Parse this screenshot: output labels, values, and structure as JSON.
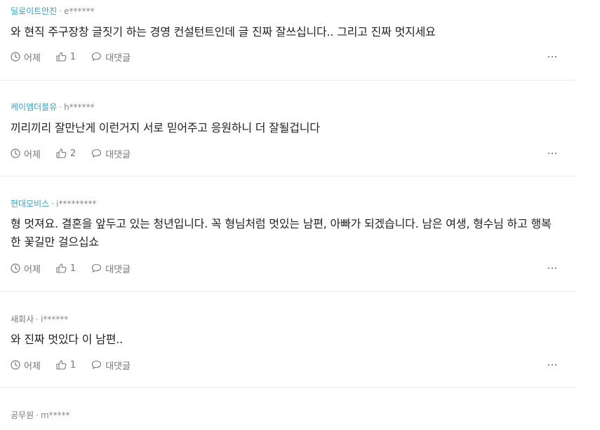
{
  "comments": [
    {
      "company": "딜로이트안진",
      "user": "e******",
      "text": "와 현직 주구장창 글짓기 하는 경영 컨설턴트인데 글 진짜 잘쓰십니다.. 그리고 진짜 멋지세요",
      "time": "어제",
      "likes": "1",
      "reply": "대댓글"
    },
    {
      "company": "케이엠더블유",
      "user": "h******",
      "text": "끼리끼리 잘만난게 이런거지 서로 믿어주고 응원하니 더 잘될겁니다",
      "time": "어제",
      "likes": "2",
      "reply": "대댓글"
    },
    {
      "company": "현대모비스",
      "user": "i*********",
      "text": "형 멋져요. 결혼을 앞두고 있는 청년입니다. 꼭 형님처럼 멋있는 남편, 아빠가 되겠습니다. 남은 여생, 형수님 하고 행복한 꽃길만 걸으십쇼",
      "time": "어제",
      "likes": "1",
      "reply": "대댓글"
    },
    {
      "company": "새회사",
      "user": "i******",
      "text": "와 진짜 멋있다 이 남편..",
      "time": "어제",
      "likes": "1",
      "reply": "대댓글"
    },
    {
      "company": "공무원",
      "user": "m*****"
    }
  ],
  "colors": {
    "company_link": "#3a9ec4",
    "company_plain": "#777777",
    "meta_text": "#888888",
    "divider": "#ececec"
  },
  "icons": {
    "time": "clock-icon",
    "like": "thumbs-up-icon",
    "reply": "speech-bubble-icon",
    "more": "more-dots-icon"
  }
}
